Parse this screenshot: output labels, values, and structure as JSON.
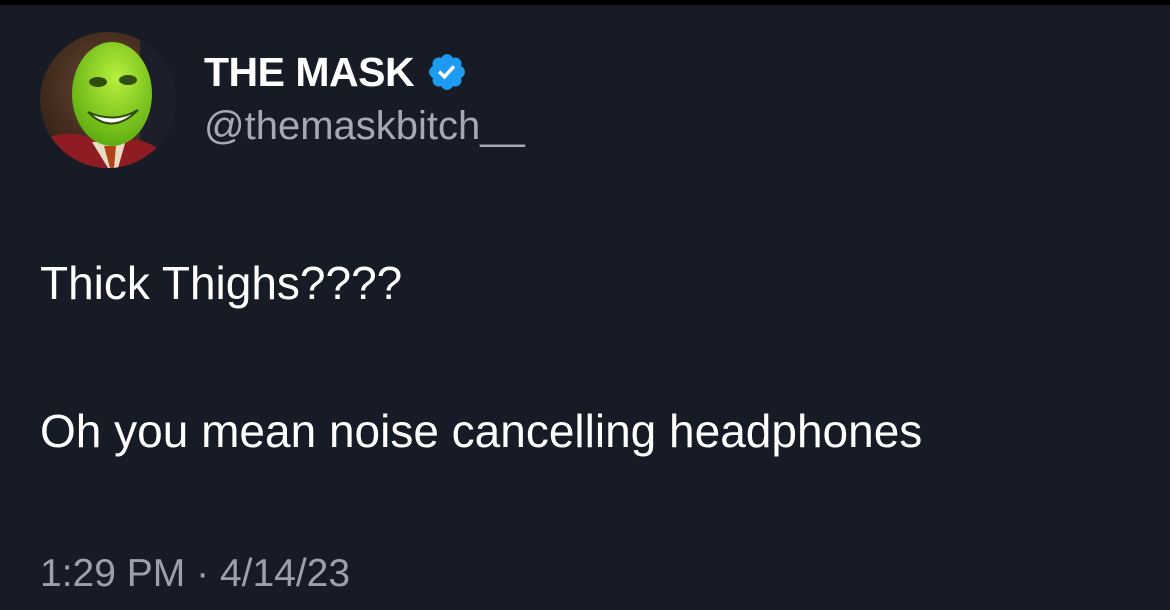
{
  "tweet": {
    "author": {
      "display_name": "THE MASK",
      "handle": "@themaskbitch__",
      "verified": true,
      "avatar_icon": "profile-avatar"
    },
    "lines": [
      "Thick Thighs????",
      "Oh you mean noise cancelling headphones"
    ],
    "time": "1:29 PM",
    "separator": "·",
    "date": "4/14/23"
  },
  "colors": {
    "background": "#161b26",
    "text": "#ffffff",
    "secondary_text": "#a3aab3",
    "verified_badge": "#1d9bf0"
  }
}
